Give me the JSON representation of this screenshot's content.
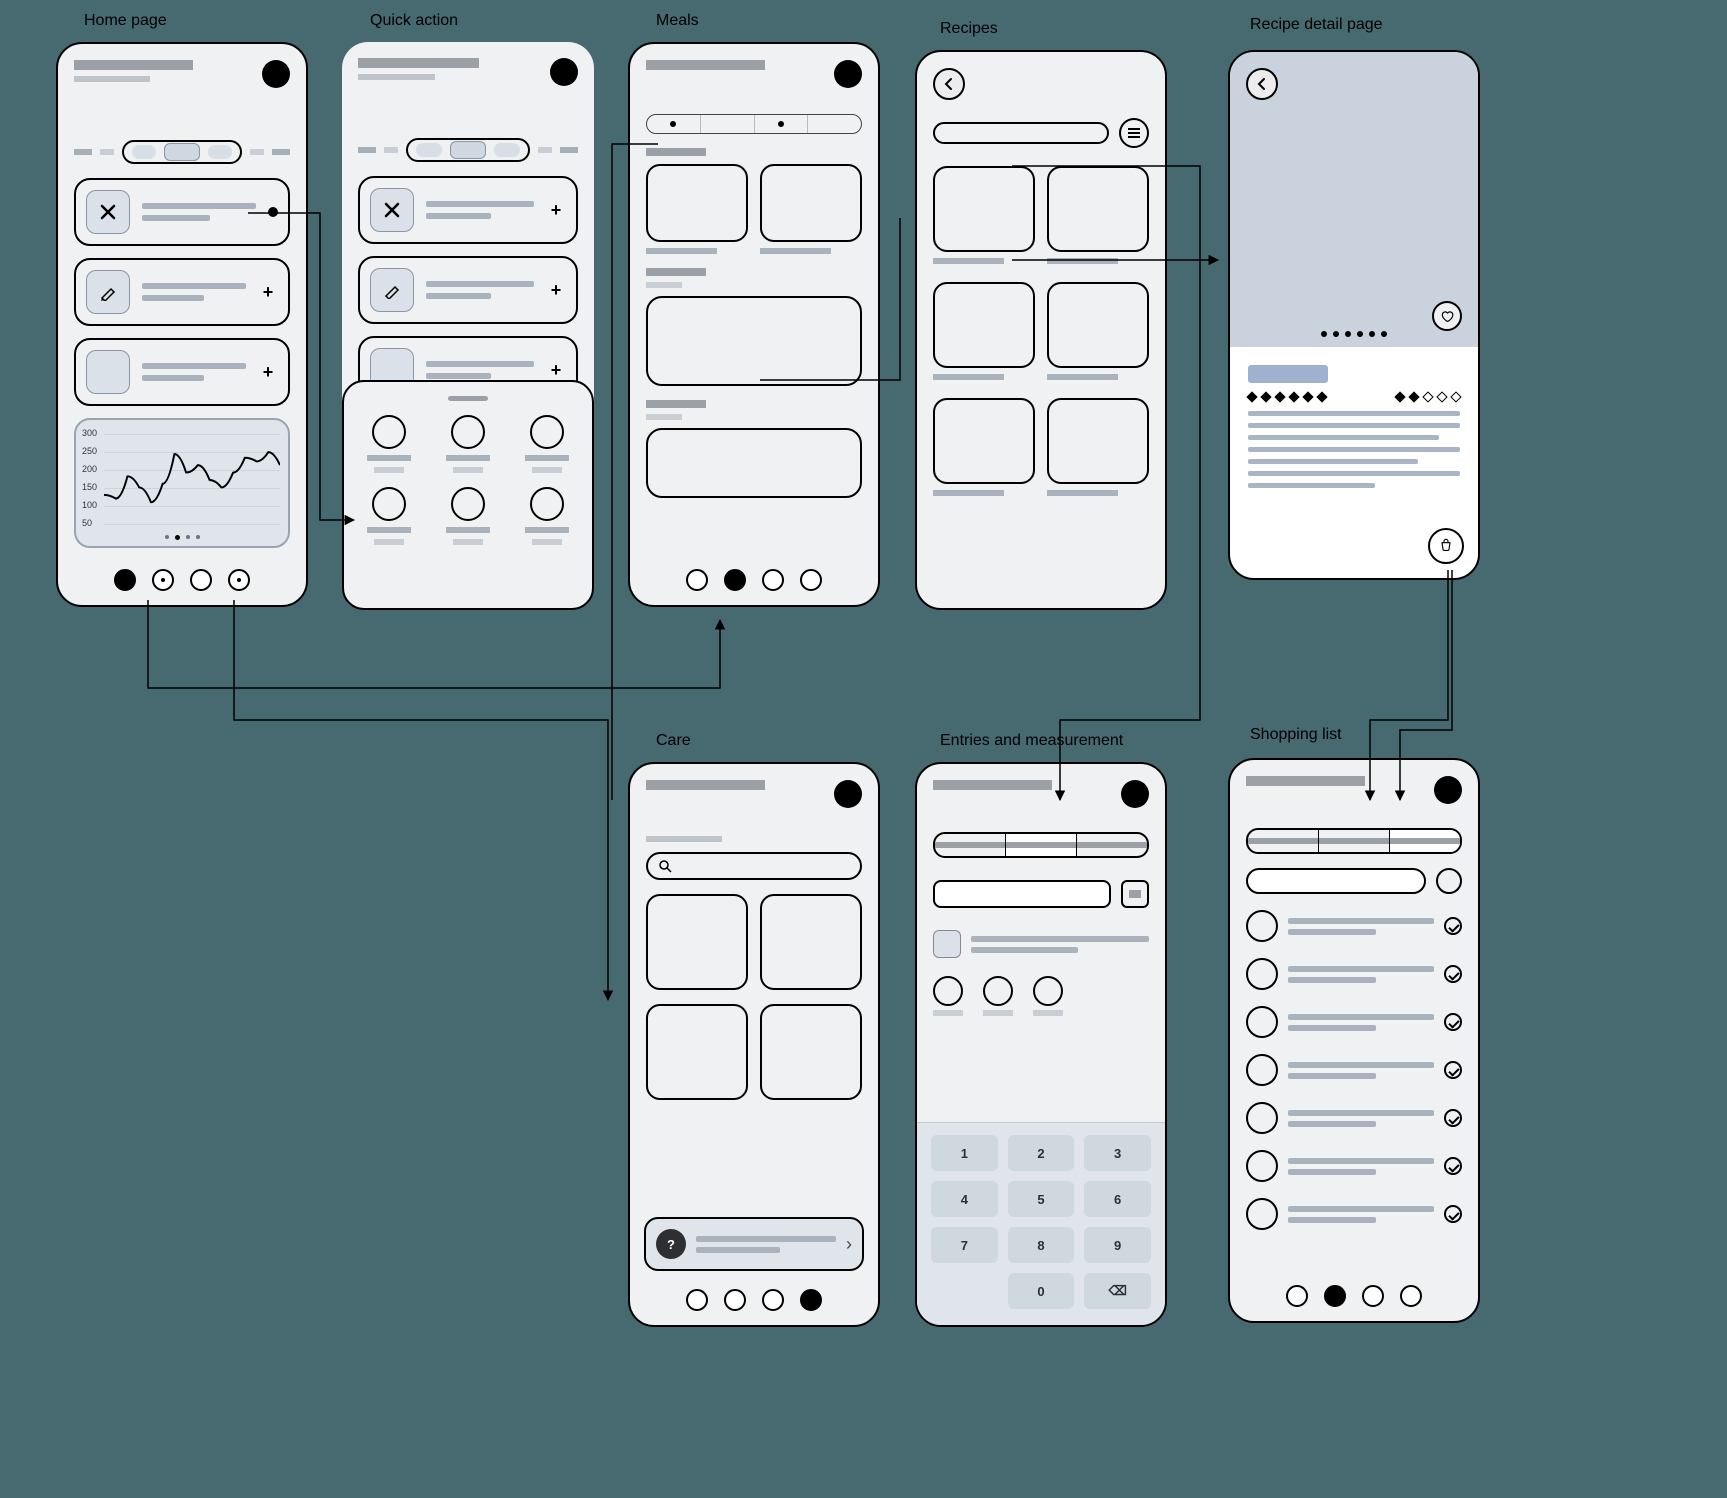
{
  "labels": {
    "home": "Home page",
    "quick": "Quick action",
    "meals": "Meals",
    "recipes": "Recipes",
    "recipe_detail": "Recipe detail page",
    "care": "Care",
    "entries": "Entries and measurement",
    "shopping": "Shopping list"
  },
  "home": {
    "cards": [
      {
        "icon": "close-icon",
        "action": "dot"
      },
      {
        "icon": "edit-icon",
        "action": "plus"
      },
      {
        "icon": "blank",
        "action": "plus"
      }
    ],
    "nav_active": 0
  },
  "quick_action": {
    "cards": [
      {
        "icon": "close-icon",
        "action": "plus"
      },
      {
        "icon": "edit-icon",
        "action": "plus"
      },
      {
        "icon": "blank",
        "action": "plus"
      }
    ],
    "sheet_items": 6
  },
  "meals": {
    "tabs": 4,
    "nav_active": 1
  },
  "recipes": {
    "tile_count": 6
  },
  "recipe_detail": {
    "hero_dots": 6,
    "rating_full": 6,
    "rating_empty": 4
  },
  "care": {
    "tile_count": 4,
    "nav_active": 3,
    "help_icon": "?"
  },
  "entries": {
    "tabs": 3,
    "active_tab": 1,
    "keypad": [
      "1",
      "2",
      "3",
      "4",
      "5",
      "6",
      "7",
      "8",
      "9",
      "",
      "0",
      "⌫"
    ]
  },
  "shopping": {
    "tabs": 3,
    "active_tab": 2,
    "items": 7,
    "nav_active": 1
  },
  "chart_data": {
    "type": "line",
    "y_ticks": [
      300,
      250,
      200,
      150,
      100,
      50
    ],
    "ylim": [
      50,
      300
    ],
    "values": [
      120,
      110,
      170,
      140,
      100,
      150,
      230,
      180,
      200,
      160,
      140,
      180,
      220,
      210,
      235,
      200
    ],
    "title": "",
    "xlabel": "",
    "ylabel": ""
  }
}
